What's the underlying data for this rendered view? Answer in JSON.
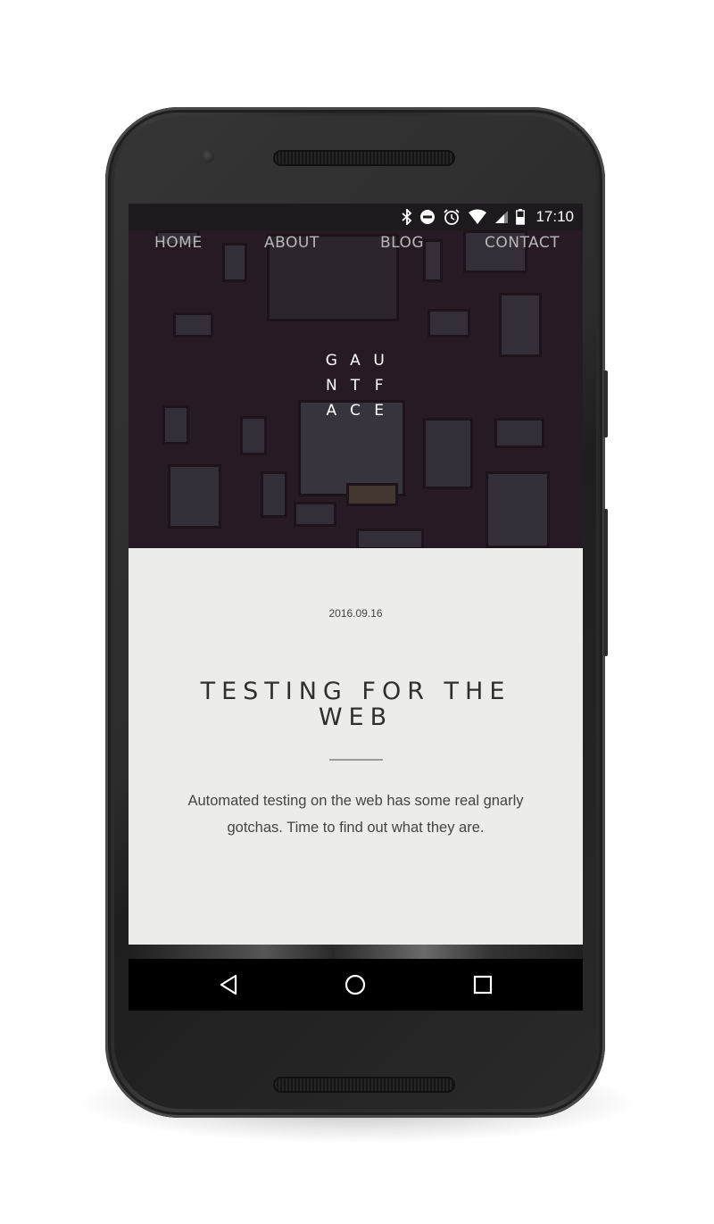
{
  "status_bar": {
    "time": "17:10",
    "icons": [
      "bluetooth-icon",
      "do-not-disturb-icon",
      "alarm-icon",
      "wifi-icon",
      "cell-signal-icon",
      "battery-icon"
    ]
  },
  "site": {
    "nav": [
      "HOME",
      "ABOUT",
      "BLOG",
      "CONTACT"
    ],
    "logo_letters": [
      "G",
      "A",
      "U",
      "N",
      "T",
      "F",
      "A",
      "C",
      "E"
    ]
  },
  "post": {
    "date": "2016.09.16",
    "title": "TESTING FOR THE WEB",
    "excerpt": "Automated testing on the web has some real gnarly gotchas. Time to find out what they are."
  },
  "android_nav": {
    "buttons": [
      "back-icon",
      "home-icon",
      "recents-icon"
    ]
  },
  "colors": {
    "hero_background": "#2b2029",
    "content_background": "#ececea",
    "nav_text": "#b9b6ba",
    "title_text": "#2f2f2f"
  }
}
